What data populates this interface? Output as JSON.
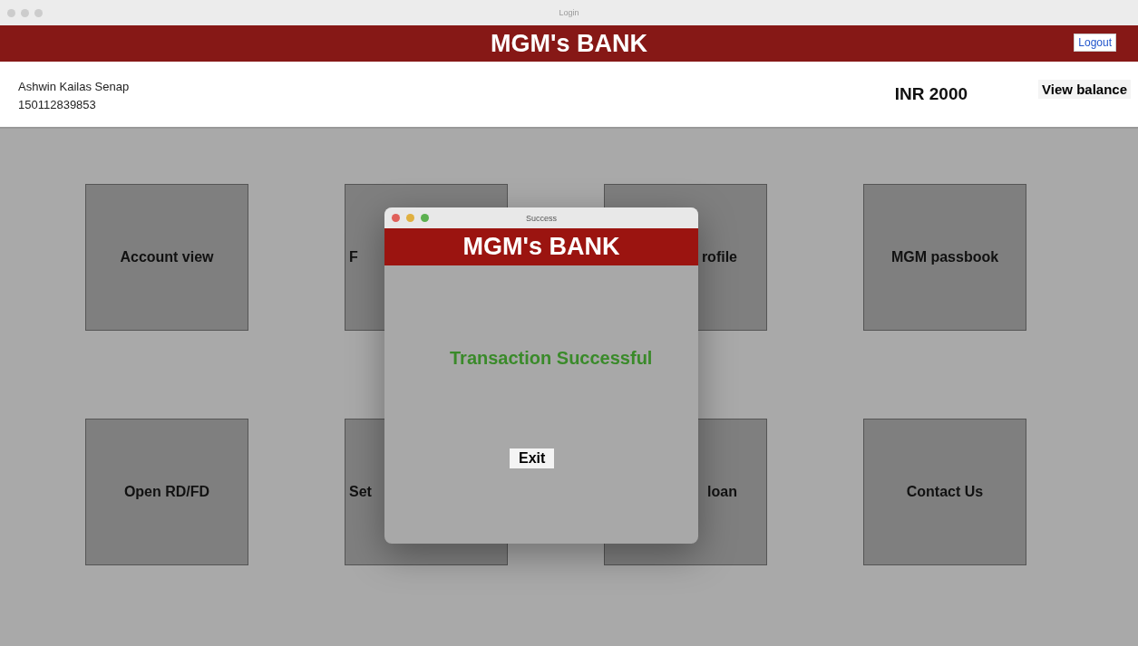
{
  "window": {
    "title": "Login"
  },
  "header": {
    "title": "MGM's BANK",
    "logout": "Logout"
  },
  "account": {
    "name": "Ashwin Kailas Senap",
    "number": "150112839853",
    "balance": "INR 2000",
    "view_balance": "View balance"
  },
  "tiles": [
    {
      "label": "Account view",
      "kind": "whole"
    },
    {
      "label": "F",
      "kind": "head"
    },
    {
      "label": "rofile",
      "kind": "tail"
    },
    {
      "label": "MGM passbook",
      "kind": "whole"
    },
    {
      "label": "Open RD/FD",
      "kind": "whole"
    },
    {
      "label": "Set",
      "kind": "head"
    },
    {
      "label": "loan",
      "kind": "tail"
    },
    {
      "label": "Contact Us",
      "kind": "whole"
    }
  ],
  "dialog": {
    "title": "Success",
    "banner": "MGM's BANK",
    "message": "Transaction Successful",
    "button": "Exit"
  }
}
